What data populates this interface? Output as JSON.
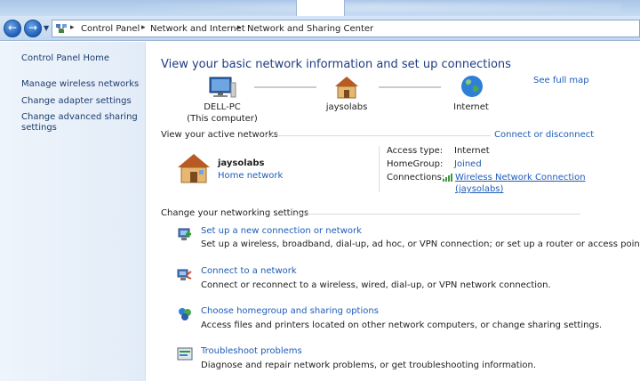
{
  "breadcrumb": {
    "items": [
      "Control Panel",
      "Network and Internet",
      "Network and Sharing Center"
    ]
  },
  "left_pane": {
    "home_link": "Control Panel Home",
    "links": [
      "Manage wireless networks",
      "Change adapter settings",
      "Change advanced sharing",
      "settings"
    ]
  },
  "main": {
    "headline": "View your basic network information and set up connections",
    "see_full_map": "See full map",
    "map": {
      "computer_name": "DELL-PC",
      "computer_sub": "(This computer)",
      "network_name": "jaysolabs",
      "internet_label": "Internet"
    },
    "active_networks": {
      "heading": "View your active networks",
      "connect_link": "Connect or disconnect",
      "network_name": "jaysolabs",
      "network_type": "Home network",
      "access_type_label": "Access type:",
      "access_type_value": "Internet",
      "homegroup_label": "HomeGroup:",
      "homegroup_value": "Joined",
      "connections_label": "Connections:",
      "connection_name": "Wireless Network Connection",
      "connection_sub": "(jaysolabs)"
    },
    "settings": {
      "heading": "Change your networking settings",
      "tasks": [
        {
          "title": "Set up a new connection or network",
          "desc": "Set up a wireless, broadband, dial-up, ad hoc, or VPN connection; or set up a router or access point.",
          "icon": "new-connection-icon"
        },
        {
          "title": "Connect to a network",
          "desc": "Connect or reconnect to a wireless, wired, dial-up, or VPN network connection.",
          "icon": "connect-network-icon"
        },
        {
          "title": "Choose homegroup and sharing options",
          "desc": "Access files and printers located on other network computers, or change sharing settings.",
          "icon": "homegroup-icon"
        },
        {
          "title": "Troubleshoot problems",
          "desc": "Diagnose and repair network problems, or get troubleshooting information.",
          "icon": "troubleshoot-icon"
        }
      ]
    }
  },
  "colors": {
    "link": "#1e5bb8",
    "headline": "#1e3c80",
    "left_pane_link": "#1e3c6e"
  }
}
